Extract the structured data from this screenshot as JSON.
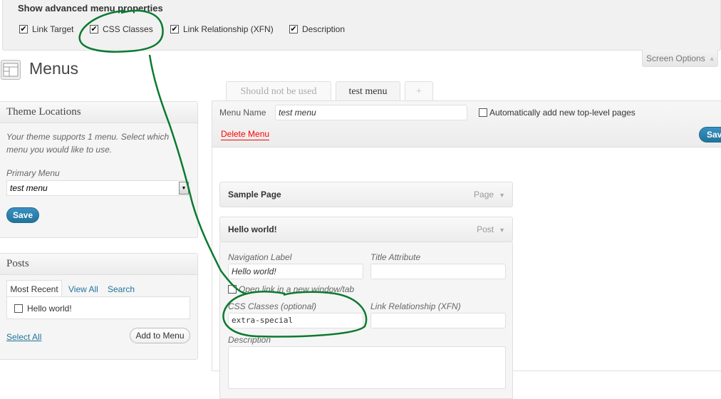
{
  "screen_options": {
    "heading": "Show advanced menu properties",
    "options": [
      {
        "label": "Link Target",
        "checked": true,
        "check_glyph": "✔"
      },
      {
        "label": "CSS Classes",
        "checked": true,
        "check_glyph": "✔"
      },
      {
        "label": "Link Relationship (XFN)",
        "checked": true,
        "check_glyph": "✔"
      },
      {
        "label": "Description",
        "checked": true,
        "check_glyph": "✔"
      }
    ],
    "tab_label": "Screen Options",
    "tab_arrow": "▲"
  },
  "page": {
    "title": "Menus",
    "icon": "menus-icon"
  },
  "theme_locations": {
    "title": "Theme Locations",
    "description": "Your theme supports 1 menu. Select which menu you would like to use.",
    "primary_label": "Primary Menu",
    "primary_value": "test menu",
    "select_arrow": "▼",
    "save_label": "Save"
  },
  "posts": {
    "title": "Posts",
    "tabs": [
      "Most Recent",
      "View All",
      "Search"
    ],
    "active_tab": "Most Recent",
    "items": [
      {
        "label": "Hello world!",
        "checked": false
      }
    ],
    "select_all": "Select All",
    "add_to_menu": "Add to Menu"
  },
  "menu_tabs": [
    {
      "label": "Should not be used",
      "active": false
    },
    {
      "label": "test menu",
      "active": true
    },
    {
      "label": "+",
      "active": false
    }
  ],
  "menu_editor": {
    "menu_name_label": "Menu Name",
    "menu_name_value": "test menu",
    "auto_add_label": "Automatically add new top-level pages",
    "auto_add_checked": false,
    "delete_label": "Delete Menu",
    "save_label": "Save Menu",
    "delete_color": "#ff0000"
  },
  "menu_items": [
    {
      "title": "Sample Page",
      "type": "Page",
      "expanded": false
    },
    {
      "title": "Hello world!",
      "type": "Post",
      "expanded": true,
      "fields": {
        "nav_label": {
          "label": "Navigation Label",
          "value": "Hello world!"
        },
        "title_attr": {
          "label": "Title Attribute",
          "value": ""
        },
        "open_new": {
          "label": "Open link in a new window/tab",
          "checked": false
        },
        "css_classes": {
          "label": "CSS Classes (optional)",
          "value": "extra-special"
        },
        "xfn": {
          "label": "Link Relationship (XFN)",
          "value": ""
        },
        "description": {
          "label": "Description",
          "value": ""
        }
      }
    }
  ],
  "colors": {
    "accent": "#21759b",
    "annotation": "#0a7a2f"
  }
}
